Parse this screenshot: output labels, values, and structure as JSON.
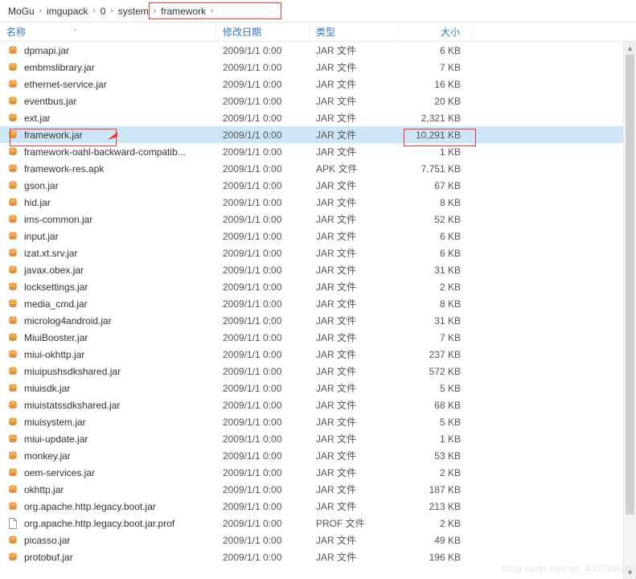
{
  "breadcrumb": [
    "MoGu",
    "imgupack",
    "0",
    "system",
    "framework"
  ],
  "columns": {
    "name": "名称",
    "date": "修改日期",
    "type": "类型",
    "size": "大小"
  },
  "selected_index": 5,
  "icons": {
    "jar": "jar-file-icon",
    "apk": "apk-file-icon",
    "prof": "prof-file-icon"
  },
  "files": [
    {
      "name": "dpmapi.jar",
      "date": "2009/1/1 0:00",
      "type": "JAR 文件",
      "size": "6 KB",
      "icon": "jar"
    },
    {
      "name": "embmslibrary.jar",
      "date": "2009/1/1 0:00",
      "type": "JAR 文件",
      "size": "7 KB",
      "icon": "jar"
    },
    {
      "name": "ethernet-service.jar",
      "date": "2009/1/1 0:00",
      "type": "JAR 文件",
      "size": "16 KB",
      "icon": "jar"
    },
    {
      "name": "eventbus.jar",
      "date": "2009/1/1 0:00",
      "type": "JAR 文件",
      "size": "20 KB",
      "icon": "jar"
    },
    {
      "name": "ext.jar",
      "date": "2009/1/1 0:00",
      "type": "JAR 文件",
      "size": "2,321 KB",
      "icon": "jar"
    },
    {
      "name": "framework.jar",
      "date": "2009/1/1 0:00",
      "type": "JAR 文件",
      "size": "10,291 KB",
      "icon": "jar"
    },
    {
      "name": "framework-oahl-backward-compatib...",
      "date": "2009/1/1 0:00",
      "type": "JAR 文件",
      "size": "1 KB",
      "icon": "jar"
    },
    {
      "name": "framework-res.apk",
      "date": "2009/1/1 0:00",
      "type": "APK 文件",
      "size": "7,751 KB",
      "icon": "apk"
    },
    {
      "name": "gson.jar",
      "date": "2009/1/1 0:00",
      "type": "JAR 文件",
      "size": "67 KB",
      "icon": "jar"
    },
    {
      "name": "hid.jar",
      "date": "2009/1/1 0:00",
      "type": "JAR 文件",
      "size": "8 KB",
      "icon": "jar"
    },
    {
      "name": "ims-common.jar",
      "date": "2009/1/1 0:00",
      "type": "JAR 文件",
      "size": "52 KB",
      "icon": "jar"
    },
    {
      "name": "input.jar",
      "date": "2009/1/1 0:00",
      "type": "JAR 文件",
      "size": "6 KB",
      "icon": "jar"
    },
    {
      "name": "izat.xt.srv.jar",
      "date": "2009/1/1 0:00",
      "type": "JAR 文件",
      "size": "6 KB",
      "icon": "jar"
    },
    {
      "name": "javax.obex.jar",
      "date": "2009/1/1 0:00",
      "type": "JAR 文件",
      "size": "31 KB",
      "icon": "jar"
    },
    {
      "name": "locksettings.jar",
      "date": "2009/1/1 0:00",
      "type": "JAR 文件",
      "size": "2 KB",
      "icon": "jar"
    },
    {
      "name": "media_cmd.jar",
      "date": "2009/1/1 0:00",
      "type": "JAR 文件",
      "size": "8 KB",
      "icon": "jar"
    },
    {
      "name": "microlog4android.jar",
      "date": "2009/1/1 0:00",
      "type": "JAR 文件",
      "size": "31 KB",
      "icon": "jar"
    },
    {
      "name": "MiuiBooster.jar",
      "date": "2009/1/1 0:00",
      "type": "JAR 文件",
      "size": "7 KB",
      "icon": "jar"
    },
    {
      "name": "miui-okhttp.jar",
      "date": "2009/1/1 0:00",
      "type": "JAR 文件",
      "size": "237 KB",
      "icon": "jar"
    },
    {
      "name": "miuipushsdkshared.jar",
      "date": "2009/1/1 0:00",
      "type": "JAR 文件",
      "size": "572 KB",
      "icon": "jar"
    },
    {
      "name": "miuisdk.jar",
      "date": "2009/1/1 0:00",
      "type": "JAR 文件",
      "size": "5 KB",
      "icon": "jar"
    },
    {
      "name": "miuistatssdkshared.jar",
      "date": "2009/1/1 0:00",
      "type": "JAR 文件",
      "size": "68 KB",
      "icon": "jar"
    },
    {
      "name": "miuisystem.jar",
      "date": "2009/1/1 0:00",
      "type": "JAR 文件",
      "size": "5 KB",
      "icon": "jar"
    },
    {
      "name": "miui-update.jar",
      "date": "2009/1/1 0:00",
      "type": "JAR 文件",
      "size": "1 KB",
      "icon": "jar"
    },
    {
      "name": "monkey.jar",
      "date": "2009/1/1 0:00",
      "type": "JAR 文件",
      "size": "53 KB",
      "icon": "jar"
    },
    {
      "name": "oem-services.jar",
      "date": "2009/1/1 0:00",
      "type": "JAR 文件",
      "size": "2 KB",
      "icon": "jar"
    },
    {
      "name": "okhttp.jar",
      "date": "2009/1/1 0:00",
      "type": "JAR 文件",
      "size": "187 KB",
      "icon": "jar"
    },
    {
      "name": "org.apache.http.legacy.boot.jar",
      "date": "2009/1/1 0:00",
      "type": "JAR 文件",
      "size": "213 KB",
      "icon": "jar"
    },
    {
      "name": "org.apache.http.legacy.boot.jar.prof",
      "date": "2009/1/1 0:00",
      "type": "PROF 文件",
      "size": "2 KB",
      "icon": "prof"
    },
    {
      "name": "picasso.jar",
      "date": "2009/1/1 0:00",
      "type": "JAR 文件",
      "size": "49 KB",
      "icon": "jar"
    },
    {
      "name": "protobuf.jar",
      "date": "2009/1/1 0:00",
      "type": "JAR 文件",
      "size": "196 KB",
      "icon": "jar"
    }
  ],
  "watermark": "blog.csdn.net/qq_43278826"
}
